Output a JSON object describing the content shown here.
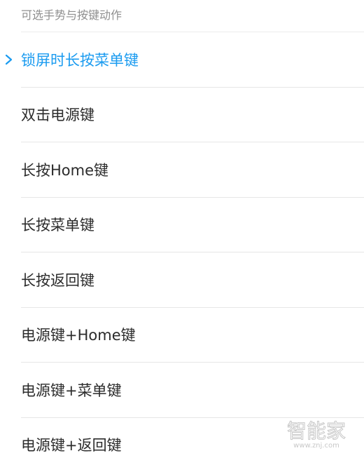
{
  "header": {
    "title": "可选手势与按键动作"
  },
  "list": {
    "items": [
      {
        "label": "锁屏时长按菜单键",
        "selected": true
      },
      {
        "label": "双击电源键",
        "selected": false
      },
      {
        "label": "长按Home键",
        "selected": false
      },
      {
        "label": "长按菜单键",
        "selected": false
      },
      {
        "label": "长按返回键",
        "selected": false
      },
      {
        "label": "电源键+Home键",
        "selected": false
      },
      {
        "label": "电源键+菜单键",
        "selected": false
      },
      {
        "label": "电源键+返回键",
        "selected": false
      }
    ]
  },
  "watermark": {
    "brand": "智能家",
    "url": "www.znj.com"
  },
  "colors": {
    "accent": "#1a9bf0",
    "text": "#2b2b2b",
    "muted": "#8f8f8f",
    "divider": "#e6e6e6"
  },
  "icons": {
    "selected_indicator": "chevron-right-icon"
  }
}
